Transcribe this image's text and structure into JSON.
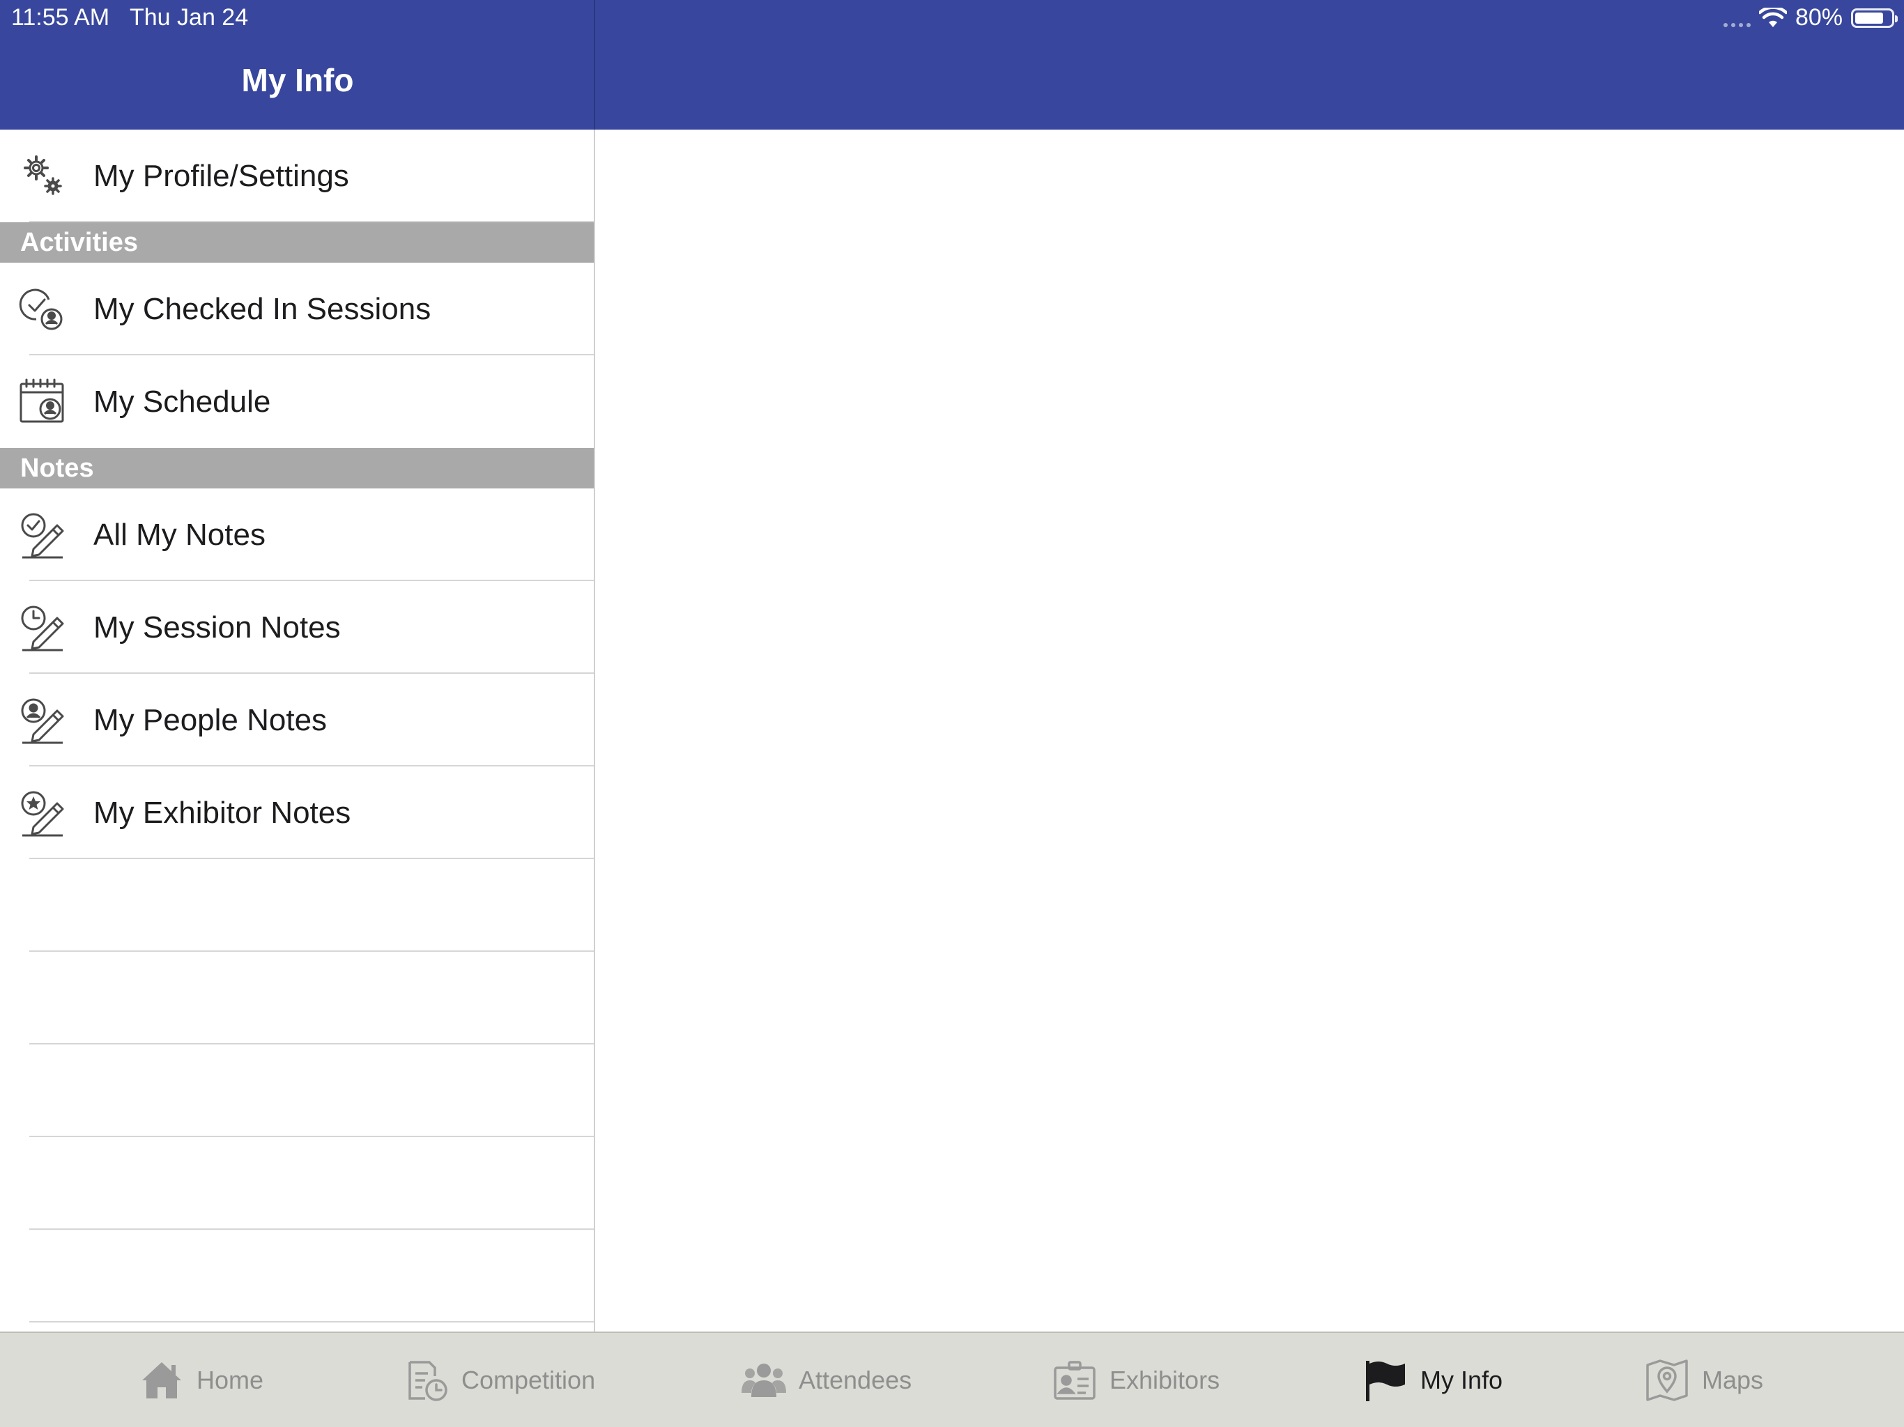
{
  "status_bar": {
    "time": "11:55 AM",
    "date": "Thu Jan 24",
    "battery": "80%",
    "battery_level": 0.8
  },
  "nav": {
    "title": "My Info"
  },
  "master": {
    "profile_item": {
      "label": "My Profile/Settings",
      "icon": "gears-icon"
    },
    "sections": [
      {
        "header": "Activities",
        "items": [
          {
            "label": "My Checked In Sessions",
            "icon": "check-person-icon"
          },
          {
            "label": "My Schedule",
            "icon": "calendar-person-icon"
          }
        ]
      },
      {
        "header": "Notes",
        "items": [
          {
            "label": "All My Notes",
            "icon": "check-note-icon"
          },
          {
            "label": "My Session Notes",
            "icon": "clock-note-icon"
          },
          {
            "label": "My People Notes",
            "icon": "person-note-icon"
          },
          {
            "label": "My Exhibitor Notes",
            "icon": "star-note-icon"
          }
        ]
      }
    ]
  },
  "tabs": [
    {
      "label": "Home",
      "icon": "home-icon",
      "active": false
    },
    {
      "label": "Competition",
      "icon": "competition-icon",
      "active": false
    },
    {
      "label": "Attendees",
      "icon": "attendees-icon",
      "active": false
    },
    {
      "label": "Exhibitors",
      "icon": "exhibitors-icon",
      "active": false
    },
    {
      "label": "My Info",
      "icon": "flag-icon",
      "active": true
    },
    {
      "label": "Maps",
      "icon": "map-icon",
      "active": false
    }
  ],
  "colors": {
    "nav_bar": "#38479d",
    "section_header": "#a9a9a9",
    "tab_bar": "#dcdcd6",
    "tab_inactive": "#8e8e8e",
    "tab_active": "#1c1c1e"
  }
}
